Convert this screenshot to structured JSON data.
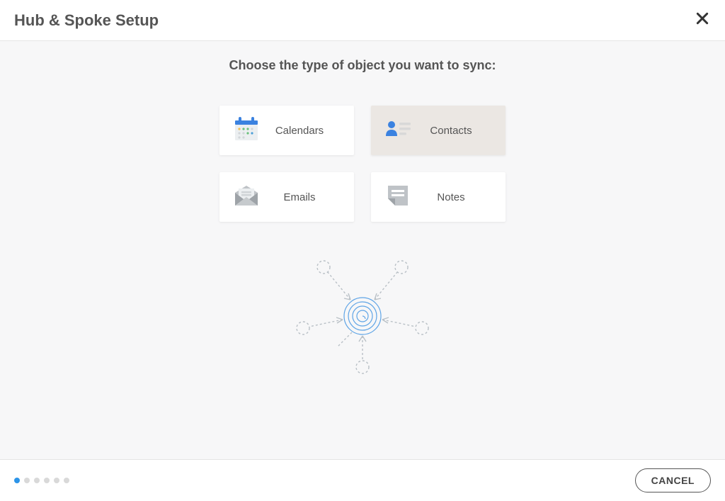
{
  "header": {
    "title": "Hub & Spoke Setup"
  },
  "main": {
    "instruction": "Choose the type of object you want to sync:",
    "options": {
      "calendars": "Calendars",
      "contacts": "Contacts",
      "emails": "Emails",
      "notes": "Notes"
    }
  },
  "footer": {
    "cancel_label": "CANCEL",
    "total_steps": 6,
    "current_step": 1
  }
}
